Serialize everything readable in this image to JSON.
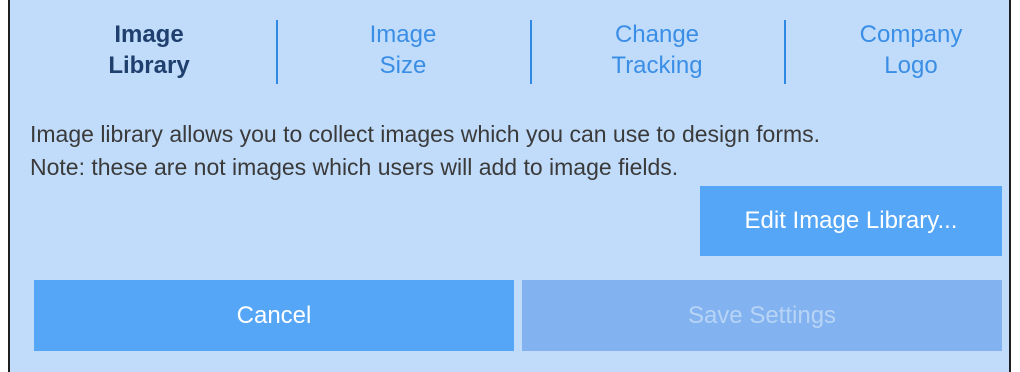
{
  "tabs": [
    {
      "line1": "Image",
      "line2": "Library",
      "active": true
    },
    {
      "line1": "Image",
      "line2": "Size",
      "active": false
    },
    {
      "line1": "Change",
      "line2": "Tracking",
      "active": false
    },
    {
      "line1": "Company",
      "line2": "Logo",
      "active": false
    }
  ],
  "description": {
    "line1": "Image library allows you to collect images which you can use to design forms.",
    "line2": "Note: these are not images which users will add to image fields."
  },
  "buttons": {
    "edit_library": "Edit Image Library...",
    "cancel": "Cancel",
    "save": "Save Settings"
  },
  "colors": {
    "panel_background": "#c0dcfa",
    "active_tab_text": "#1f3f6e",
    "inactive_tab_text": "#3a8ee6",
    "button_primary": "#55a6f6",
    "button_disabled": "#82b2ef"
  }
}
